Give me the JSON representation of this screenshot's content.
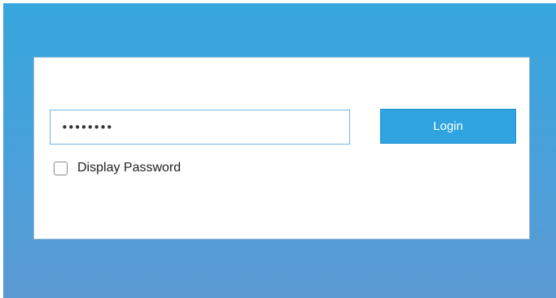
{
  "login_form": {
    "password_value": "••••••••",
    "login_label": "Login",
    "display_password_label": "Display Password",
    "display_password_checked": false
  },
  "colors": {
    "background_top": "#36a6dd",
    "background_bottom": "#5b99d2",
    "button": "#2ea3e0",
    "input_border": "#6fb6e6"
  }
}
